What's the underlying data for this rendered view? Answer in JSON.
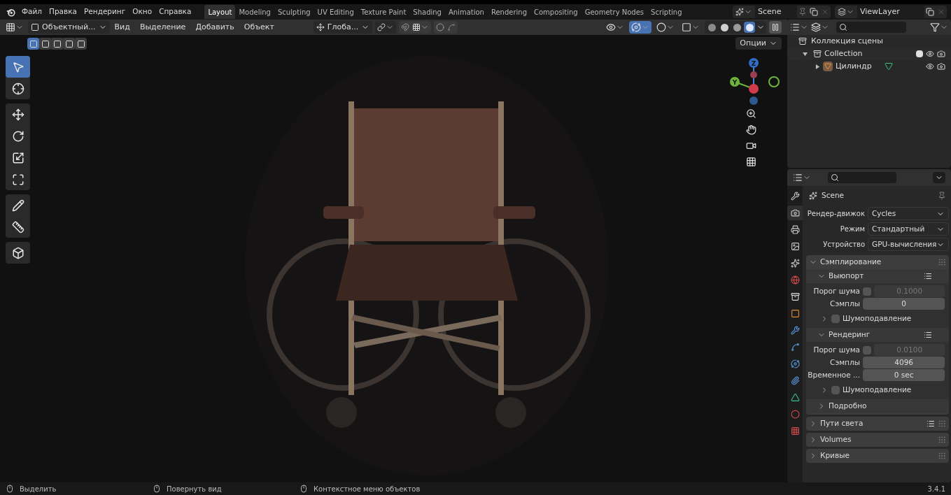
{
  "menu": [
    "Файл",
    "Правка",
    "Рендеринг",
    "Окно",
    "Справка"
  ],
  "workspaces": [
    {
      "label": "Layout",
      "selected": true
    },
    {
      "label": "Modeling",
      "selected": false
    },
    {
      "label": "Sculpting",
      "selected": false
    },
    {
      "label": "UV Editing",
      "selected": false
    },
    {
      "label": "Texture Paint",
      "selected": false
    },
    {
      "label": "Shading",
      "selected": false
    },
    {
      "label": "Animation",
      "selected": false
    },
    {
      "label": "Rendering",
      "selected": false
    },
    {
      "label": "Compositing",
      "selected": false
    },
    {
      "label": "Geometry Nodes",
      "selected": false
    },
    {
      "label": "Scripting",
      "selected": false
    }
  ],
  "scene": "Scene",
  "view_layer": "ViewLayer",
  "viewport": {
    "mode": "Объектный...",
    "menus": [
      "Вид",
      "Выделение",
      "Добавить",
      "Объект"
    ],
    "orientation": "Глоба...",
    "options": "Опции",
    "select_modes": [
      {
        "selected": true
      },
      {
        "selected": false
      },
      {
        "selected": false
      },
      {
        "selected": false
      },
      {
        "selected": false
      }
    ],
    "header_toggles": [
      {
        "kind": "visibility",
        "on": false
      },
      {
        "kind": "gizmos",
        "on": true
      },
      {
        "kind": "overlays",
        "on": false
      },
      {
        "kind": "xray",
        "on": false
      }
    ],
    "shading": [
      {
        "kind": "wireframe",
        "selected": false
      },
      {
        "kind": "solid",
        "selected": false
      },
      {
        "kind": "material",
        "selected": false
      },
      {
        "kind": "rendered",
        "selected": true
      }
    ],
    "tool_groups": [
      [
        {
          "kind": "select",
          "selected": true
        },
        {
          "kind": "cursor",
          "selected": false
        }
      ],
      [
        {
          "kind": "move",
          "selected": false
        },
        {
          "kind": "rotate",
          "selected": false
        },
        {
          "kind": "scale",
          "selected": false
        },
        {
          "kind": "transform",
          "selected": false
        }
      ],
      [
        {
          "kind": "annotate",
          "selected": false
        },
        {
          "kind": "measure",
          "selected": false
        }
      ],
      [
        {
          "kind": "add_cube",
          "selected": false
        }
      ]
    ],
    "gizmo_labels": [
      "Z",
      "Y"
    ]
  },
  "outliner": {
    "root": "Коллекция сцены",
    "items": [
      {
        "label": "Collection",
        "expanded": true,
        "checked": true,
        "children": [
          {
            "label": "Цилиндр",
            "expanded": false
          }
        ]
      }
    ]
  },
  "properties": {
    "context": "Scene",
    "tabs": [
      {
        "kind": "tool",
        "selected": false
      },
      {
        "kind": "render",
        "selected": true
      },
      {
        "kind": "output",
        "selected": false
      },
      {
        "kind": "view_layer",
        "selected": false
      },
      {
        "kind": "scene",
        "selected": false
      },
      {
        "kind": "world",
        "selected": false
      },
      {
        "kind": "collection",
        "selected": false
      },
      {
        "kind": "object",
        "selected": false
      },
      {
        "kind": "modifiers",
        "selected": false
      },
      {
        "kind": "particles",
        "selected": false
      },
      {
        "kind": "physics",
        "selected": false
      },
      {
        "kind": "constraints",
        "selected": false
      },
      {
        "kind": "data",
        "selected": false
      },
      {
        "kind": "material",
        "selected": false
      },
      {
        "kind": "texture",
        "selected": false
      }
    ],
    "fields": [
      {
        "label": "Рендер-движок",
        "value": "Cycles"
      },
      {
        "label": "Режим",
        "value": "Стандартный"
      },
      {
        "label": "Устройство",
        "value": "GPU-вычисления"
      }
    ],
    "sampling": {
      "title": "Сэмплирование",
      "expanded": true,
      "subpanels": [
        {
          "title": "Выюпорт",
          "expanded": true,
          "rows": [
            {
              "kind": "toggle_number",
              "label": "Порог шума",
              "checked": false,
              "value": "0.1000"
            },
            {
              "kind": "number",
              "label": "Сэмплы",
              "value": "0"
            }
          ],
          "denoise": {
            "label": "Шумоподавление",
            "checked": false,
            "expanded": false
          }
        },
        {
          "title": "Рендеринг",
          "expanded": true,
          "rows": [
            {
              "kind": "toggle_number",
              "label": "Порог шума",
              "checked": false,
              "value": "0.0100"
            },
            {
              "kind": "number",
              "label": "Сэмплы",
              "value": "4096"
            },
            {
              "kind": "number",
              "label": "Временное ...",
              "value": "0 sec"
            }
          ],
          "denoise": {
            "label": "Шумоподавление",
            "checked": false,
            "expanded": false
          }
        }
      ],
      "extra": {
        "title": "Подробно",
        "expanded": false
      }
    },
    "panels": [
      {
        "title": "Пути света",
        "expanded": false,
        "presets": true
      },
      {
        "title": "Volumes",
        "expanded": false,
        "presets": false
      },
      {
        "title": "Кривые",
        "expanded": false,
        "presets": false
      }
    ]
  },
  "status_bar": {
    "hints": [
      "Выделить",
      "Повернуть вид",
      "Контекстное меню объектов"
    ],
    "version": "3.4.1"
  }
}
